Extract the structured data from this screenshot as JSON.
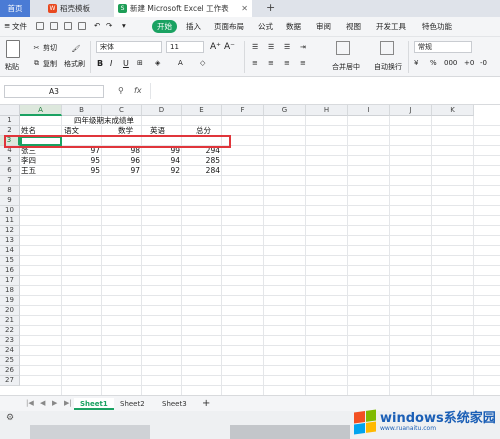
{
  "tabs": {
    "home": "首页",
    "tab1": "稻壳模板",
    "tab2": "新建 Microsoft Excel 工作表",
    "plus": "+"
  },
  "menu": {
    "file": "文件",
    "start": "开始",
    "insert": "插入",
    "page_layout": "页面布局",
    "formula": "公式",
    "data": "数据",
    "review": "审阅",
    "view": "视图",
    "dev": "开发工具",
    "special": "特色功能"
  },
  "ribbon": {
    "paste": "粘贴",
    "cut": "剪切",
    "copy": "复制",
    "format_painter": "格式刷",
    "font": "宋体",
    "size": "11",
    "merge": "合并居中",
    "wrap": "自动换行",
    "number_format": "常规",
    "percent": "%",
    "thousands": "000"
  },
  "formula_bar": {
    "cell_ref": "A3",
    "fx": "fx"
  },
  "columns": [
    "A",
    "B",
    "C",
    "D",
    "E",
    "F",
    "G",
    "H",
    "I",
    "J",
    "K"
  ],
  "rows": [
    "1",
    "2",
    "3",
    "4",
    "5",
    "6",
    "7",
    "8",
    "9",
    "10",
    "11",
    "12",
    "13",
    "14",
    "15",
    "16",
    "17",
    "18",
    "19",
    "20",
    "21",
    "22",
    "23",
    "24",
    "25",
    "26",
    "27"
  ],
  "sheet": {
    "title": "四年级期末成绩单",
    "headers": [
      "姓名",
      "语文",
      "数学",
      "英语",
      "总分"
    ],
    "records": [
      {
        "name": "张三",
        "chinese": "97",
        "math": "98",
        "english": "99",
        "total": "294"
      },
      {
        "name": "李四",
        "chinese": "95",
        "math": "96",
        "english": "94",
        "total": "285"
      },
      {
        "name": "王五",
        "chinese": "95",
        "math": "97",
        "english": "92",
        "total": "284"
      }
    ]
  },
  "sheet_tabs": [
    "Sheet1",
    "Sheet2",
    "Sheet3"
  ],
  "add_sheet": "+",
  "watermark": {
    "brand": "windows系统家园",
    "url": "www.ruanaitu.com"
  }
}
